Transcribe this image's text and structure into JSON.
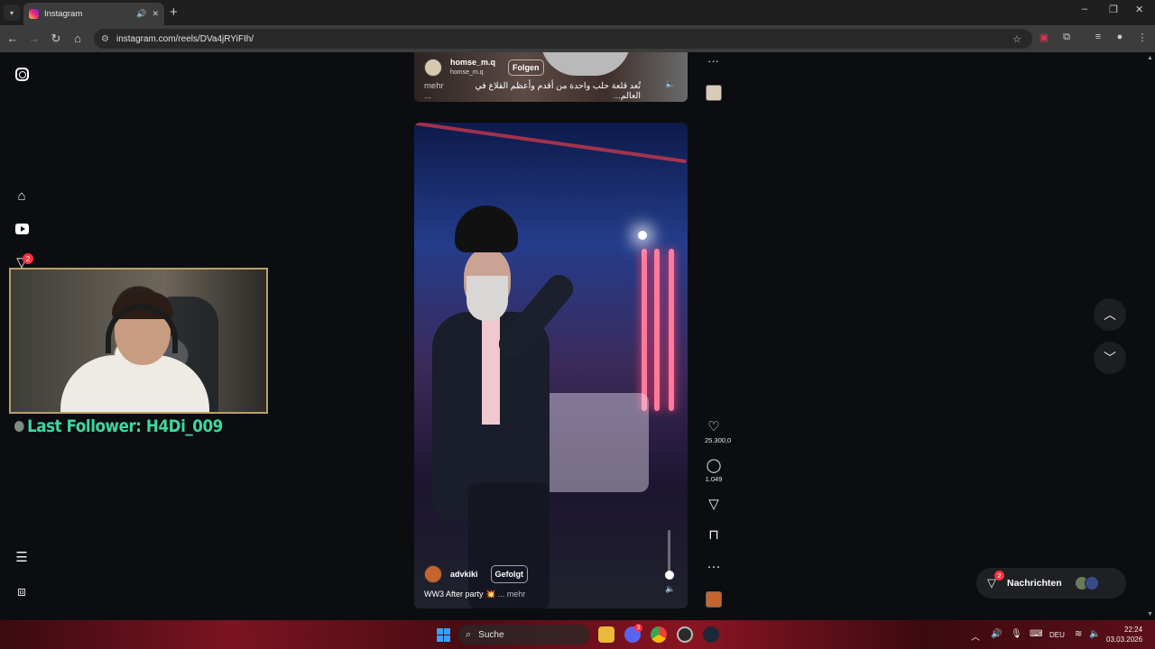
{
  "browser": {
    "tab_title": "Instagram",
    "new_tab": "+",
    "url": "instagram.com/reels/DVa4jRYiFIh/",
    "window_controls": [
      "–",
      "❐",
      "✕"
    ]
  },
  "sidebar": {
    "notification_count": "2"
  },
  "stream_overlay": {
    "last_follower": "Last Follower: H4Di_009"
  },
  "previous_reel": {
    "username": "homse_m.q",
    "subname": "homse_m.q",
    "follow_label": "Folgen",
    "caption": "تُعد قلعة حلب واحدة من أقدم وأعظم القلاع في العالم...",
    "more_label": "mehr ..."
  },
  "reel": {
    "username": "advkiki",
    "follow_label": "Gefolgt",
    "caption": "WW3 After party 💥",
    "more_label": "... mehr",
    "likes": "25.300,0",
    "comments": "1.049"
  },
  "messages": {
    "label": "Nachrichten",
    "badge": "2"
  },
  "taskbar": {
    "search_label": "Suche",
    "language": "DEU",
    "time": "22:24",
    "date": "03.03.2026",
    "discord_badge": "3"
  },
  "colors": {
    "accent_red": "#ff3040",
    "follower_text": "#3fd6a0",
    "webcam_border": "#b8a06a"
  },
  "icons": [
    "instagram-icon",
    "home-icon",
    "reels-icon",
    "send-icon",
    "menu-icon",
    "more-icon",
    "heart-icon",
    "comment-icon",
    "share-icon",
    "bookmark-icon",
    "chevron-up-icon",
    "chevron-down-icon",
    "windows-icon",
    "search-icon"
  ]
}
